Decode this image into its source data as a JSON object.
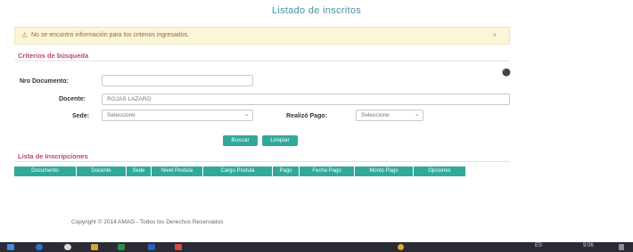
{
  "page": {
    "title": "Listado de inscritos"
  },
  "alert": {
    "icon": "warning-icon",
    "message": "No se encontró información para los criterios ingresados.",
    "close": "×"
  },
  "criteria": {
    "heading": "Criterios de búsqueda",
    "toggle_icon": "collapse-icon",
    "doc_label": "Nro Documento:",
    "doc_value": "",
    "docente_label": "Docente:",
    "docente_value": "ROJAS LAZARO",
    "sede_label": "Sede:",
    "sede_value": "Seleccione",
    "pago_label": "Realizó Pago:",
    "pago_value": "Seleccione"
  },
  "buttons": {
    "search": "Buscar",
    "clean": "Limpiar"
  },
  "list": {
    "heading": "Lista de Inscripciones",
    "columns": [
      "Documento",
      "Docente",
      "Sede",
      "Nivel Postula",
      "Cargo Postula",
      "Pago",
      "Fecha Pago",
      "Monto Pago",
      "Opciones"
    ]
  },
  "footer": {
    "text": "Copyright © 2014 AMAG - Todos los Derechos Reservados"
  },
  "taskbar": {
    "tray_text": "ES",
    "time": "9:06",
    "colors": {
      "bar": "#2a2b35",
      "accent": "#30a99a"
    }
  }
}
